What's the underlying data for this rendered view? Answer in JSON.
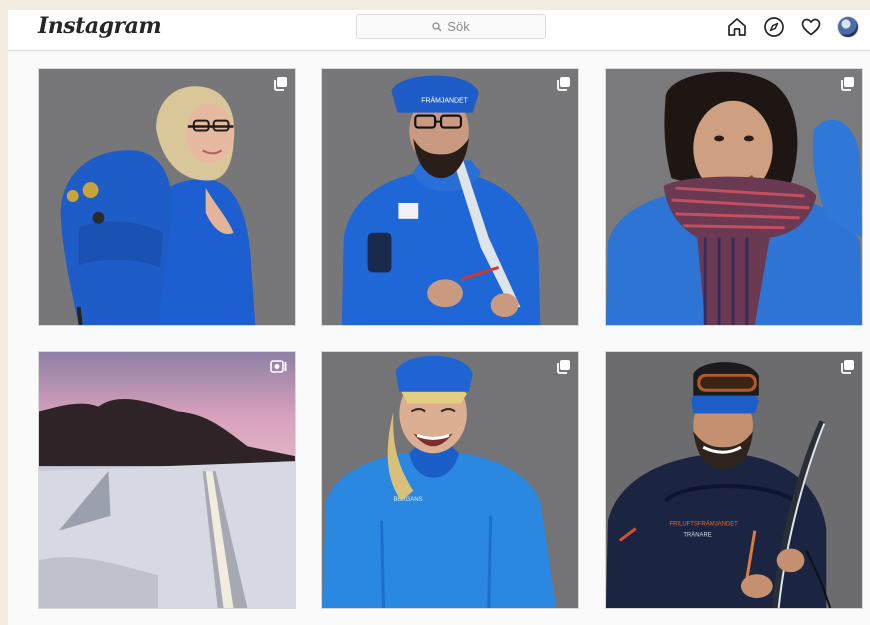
{
  "header": {
    "logo": "Instagram",
    "search_placeholder": "Sök",
    "nav_icons": [
      "home-icon",
      "explore-icon",
      "heart-icon",
      "profile-avatar"
    ]
  },
  "grid": {
    "posts": [
      {
        "badge": "carousel-icon",
        "subject": "woman with blue backpack"
      },
      {
        "badge": "carousel-icon",
        "subject": "bearded man cutting climbing skin"
      },
      {
        "badge": "carousel-icon",
        "subject": "woman with striped scarf"
      },
      {
        "badge": "igtv-icon",
        "subject": "ski tracks in snow at dusk"
      },
      {
        "badge": "carousel-icon",
        "subject": "laughing woman in blue headband"
      },
      {
        "badge": "carousel-icon",
        "subject": "man with goggles holding ski"
      }
    ]
  },
  "colors": {
    "accent_blue": "#1a6fd6",
    "header_border": "#dbdbdb",
    "text": "#262626"
  }
}
